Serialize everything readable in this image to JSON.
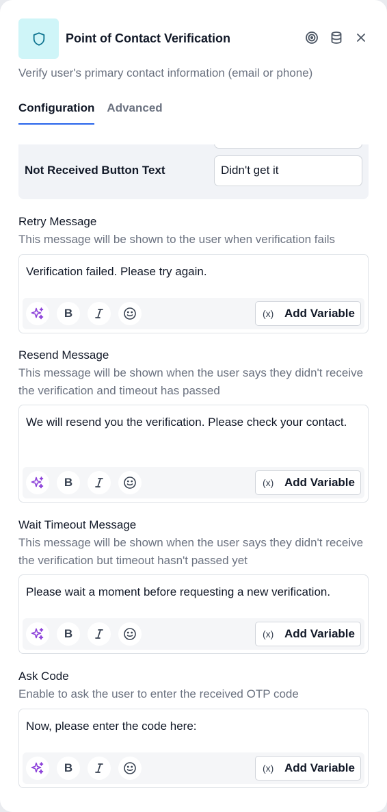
{
  "header": {
    "title": "Point of Contact Verification",
    "subtitle": "Verify user's primary contact information (email or phone)",
    "icons": [
      "shield-icon",
      "target-icon",
      "database-icon",
      "close-icon"
    ]
  },
  "tabs": [
    {
      "label": "Configuration",
      "active": true
    },
    {
      "label": "Advanced",
      "active": false
    }
  ],
  "not_received": {
    "label": "Not Received Button Text",
    "value": "Didn't get it"
  },
  "toolbar": {
    "add_variable": "Add Variable",
    "bold_glyph": "B",
    "italic_glyph": "I",
    "variable_glyph": "(x)"
  },
  "sections": [
    {
      "title": "Retry Message",
      "description": "This message will be shown to the user when verification fails",
      "text": "Verification failed. Please try again."
    },
    {
      "title": "Resend Message",
      "description": "This message will be shown when the user says they didn't receive the verification and timeout has passed",
      "text": "We will resend you the verification. Please check your contact."
    },
    {
      "title": "Wait Timeout Message",
      "description": "This message will be shown when the user says they didn't receive the verification but timeout hasn't passed yet",
      "text": "Please wait a moment before requesting a new verification."
    },
    {
      "title": "Ask Code",
      "description": "Enable to ask the user to enter the received OTP code",
      "text": "Now, please enter the code here:"
    }
  ],
  "colors": {
    "accent": "#2563eb",
    "badge_bg": "#cff5f8",
    "badge_icon": "#0e7490",
    "sparkle": "#8b3fd9"
  }
}
